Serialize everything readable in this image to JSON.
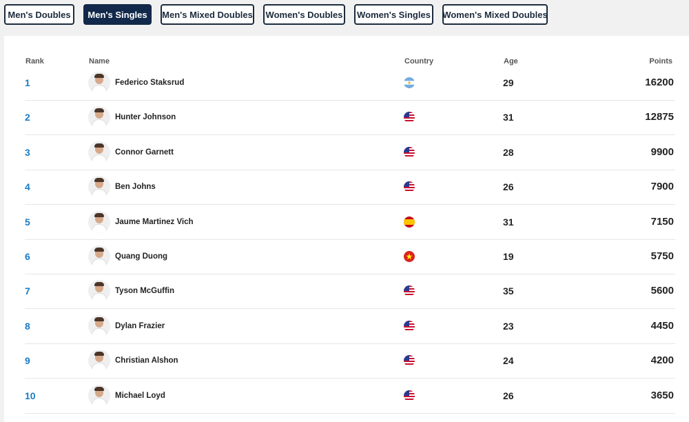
{
  "tabs": [
    {
      "label": "Men's Doubles",
      "active": false
    },
    {
      "label": "Men's Singles",
      "active": true
    },
    {
      "label": "Men's Mixed Doubles",
      "active": false
    },
    {
      "label": "Women's Doubles",
      "active": false
    },
    {
      "label": "Women's Singles",
      "active": false
    },
    {
      "label": "Women's Mixed Doubles",
      "active": false
    }
  ],
  "table": {
    "headers": {
      "rank": "Rank",
      "name": "Name",
      "country": "Country",
      "age": "Age",
      "points": "Points"
    },
    "rows": [
      {
        "rank": "1",
        "name": "Federico Staksrud",
        "country": "argentina-flag-icon",
        "age": "29",
        "points": "16200"
      },
      {
        "rank": "2",
        "name": "Hunter Johnson",
        "country": "usa-flag-icon",
        "age": "31",
        "points": "12875"
      },
      {
        "rank": "3",
        "name": "Connor Garnett",
        "country": "usa-flag-icon",
        "age": "28",
        "points": "9900"
      },
      {
        "rank": "4",
        "name": "Ben Johns",
        "country": "usa-flag-icon",
        "age": "26",
        "points": "7900"
      },
      {
        "rank": "5",
        "name": "Jaume Martinez Vich",
        "country": "spain-flag-icon",
        "age": "31",
        "points": "7150"
      },
      {
        "rank": "6",
        "name": "Quang Duong",
        "country": "vietnam-flag-icon",
        "age": "19",
        "points": "5750"
      },
      {
        "rank": "7",
        "name": "Tyson McGuffin",
        "country": "usa-flag-icon",
        "age": "35",
        "points": "5600"
      },
      {
        "rank": "8",
        "name": "Dylan Frazier",
        "country": "usa-flag-icon",
        "age": "23",
        "points": "4450"
      },
      {
        "rank": "9",
        "name": "Christian Alshon",
        "country": "usa-flag-icon",
        "age": "24",
        "points": "4200"
      },
      {
        "rank": "10",
        "name": "Michael Loyd",
        "country": "usa-flag-icon",
        "age": "26",
        "points": "3650"
      }
    ]
  },
  "colors": {
    "accent_navy": "#13294b",
    "rank_blue": "#1a7bc4"
  }
}
